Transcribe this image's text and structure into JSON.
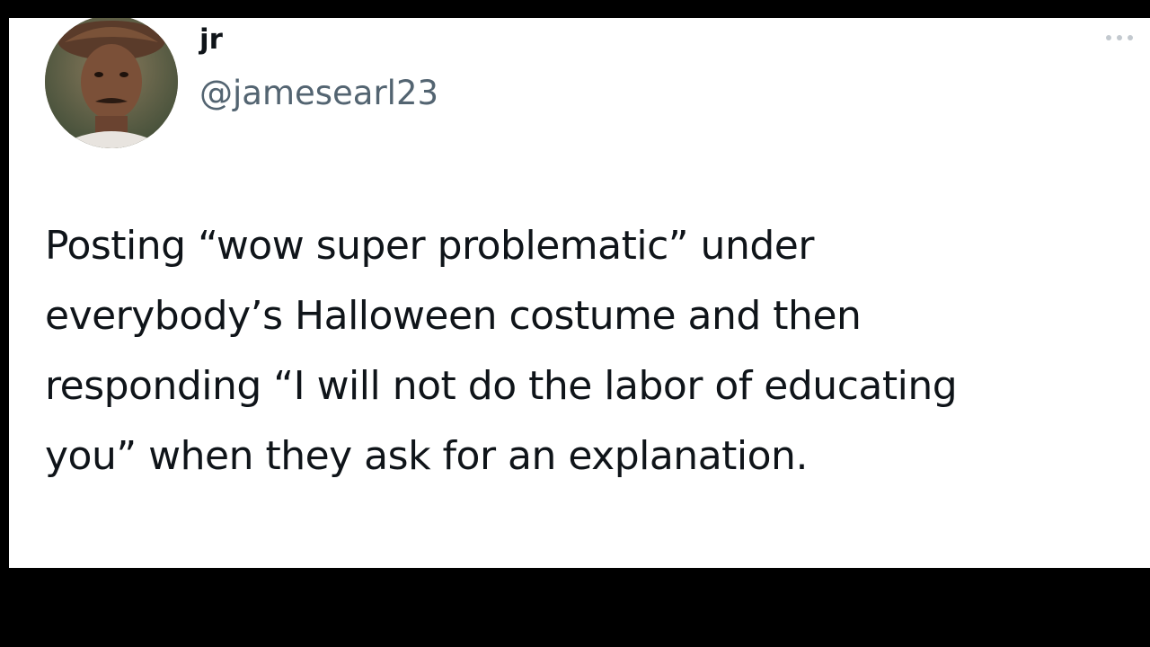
{
  "tweet": {
    "display_name": "jr",
    "handle": "@jamesearl23",
    "text_lines": [
      "Posting “wow super problematic” under",
      "everybody’s Halloween costume and then",
      "responding “I will not do the labor of educating",
      "you” when they ask for an explanation."
    ],
    "more_icon": "more-dots-icon",
    "avatar": "profile-photo"
  },
  "colors": {
    "background": "#000000",
    "card": "#ffffff",
    "text": "#0f1419",
    "secondary_text": "#536471"
  }
}
